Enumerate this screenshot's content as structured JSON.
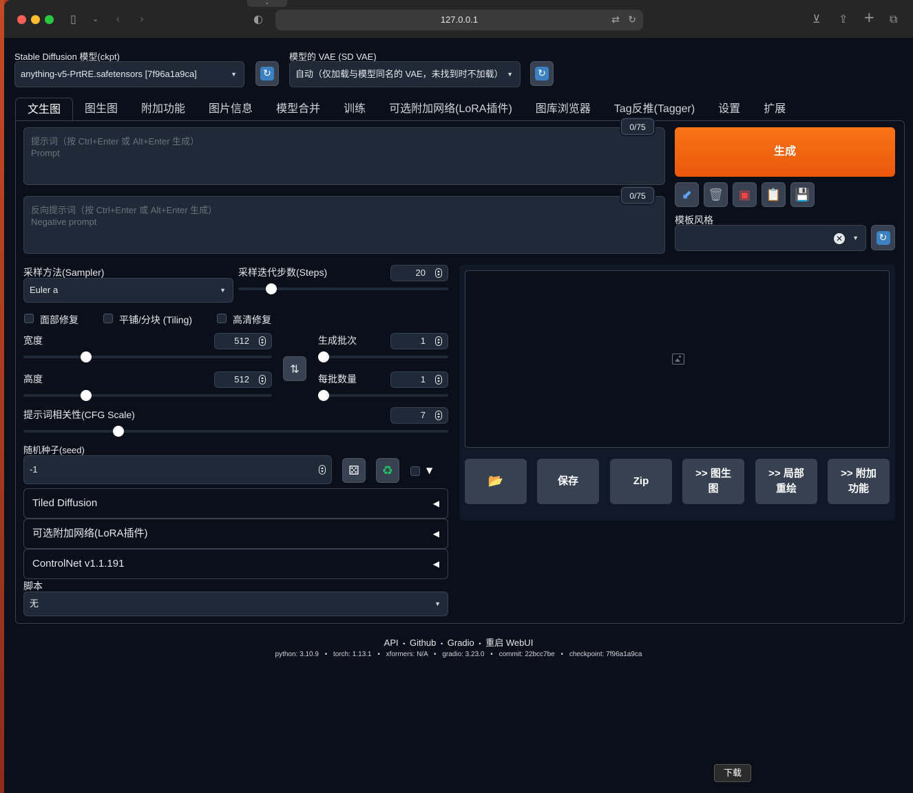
{
  "browser": {
    "url": "127.0.0.1",
    "colors": {
      "close": "#ff5f57",
      "minimize": "#febc2e",
      "maximize": "#28c840"
    }
  },
  "model": {
    "ckpt_label": "Stable Diffusion 模型(ckpt)",
    "ckpt_value": "anything-v5-PrtRE.safetensors [7f96a1a9ca]",
    "vae_label": "模型的 VAE (SD VAE)",
    "vae_value": "自动（仅加载与模型同名的 VAE，未找到时不加载）"
  },
  "tabs": [
    {
      "label": "文生图",
      "active": true
    },
    {
      "label": "图生图"
    },
    {
      "label": "附加功能"
    },
    {
      "label": "图片信息"
    },
    {
      "label": "模型合并"
    },
    {
      "label": "训练"
    },
    {
      "label": "可选附加网络(LoRA插件)"
    },
    {
      "label": "图库浏览器"
    },
    {
      "label": "Tag反推(Tagger)"
    },
    {
      "label": "设置"
    },
    {
      "label": "扩展"
    }
  ],
  "prompt": {
    "placeholder_line1": "提示词（按 Ctrl+Enter 或 Alt+Enter 生成）",
    "placeholder_line2": "Prompt",
    "token_count": "0/75"
  },
  "negative_prompt": {
    "placeholder_line1": "反向提示词（按 Ctrl+Enter 或 Alt+Enter 生成）",
    "placeholder_line2": "Negative prompt",
    "token_count": "0/75"
  },
  "generate": {
    "label": "生成",
    "color": "#f97316"
  },
  "style": {
    "label": "模板风格",
    "clear": "✕"
  },
  "sampler": {
    "label": "采样方法(Sampler)",
    "value": "Euler a"
  },
  "steps": {
    "label": "采样迭代步数(Steps)",
    "value": "20",
    "level": 0.13
  },
  "checkboxes": {
    "face_restore": "面部修复",
    "tiling": "平铺/分块 (Tiling)",
    "hires_fix": "高清修复"
  },
  "width": {
    "label": "宽度",
    "value": "512",
    "level": 0.23
  },
  "height": {
    "label": "高度",
    "value": "512",
    "level": 0.23
  },
  "batch_count": {
    "label": "生成批次",
    "value": "1",
    "level": 0.0
  },
  "batch_size": {
    "label": "每批数量",
    "value": "1",
    "level": 0.0
  },
  "cfg": {
    "label": "提示词相关性(CFG Scale)",
    "value": "7",
    "level": 0.21
  },
  "seed": {
    "label": "随机种子(seed)",
    "value": "-1"
  },
  "accordions": {
    "tiled_diffusion": "Tiled Diffusion",
    "lora": "可选附加网络(LoRA插件)",
    "controlnet": "ControlNet v1.1.191"
  },
  "script": {
    "label": "脚本",
    "value": "无"
  },
  "output_buttons": {
    "save": "保存",
    "zip": "Zip",
    "to_img2img": ">> 图生图",
    "to_inpaint": ">> 局部重绘",
    "to_extras": ">> 附加功能"
  },
  "footer": {
    "api": "API",
    "github": "Github",
    "gradio": "Gradio",
    "reload": "重启 WebUI",
    "sep": "•",
    "python": "python: 3.10.9",
    "torch": "torch: 1.13.1",
    "xformers": "xformers: N/A",
    "gradio_ver": "gradio: 3.23.0",
    "commit": "commit: 22bcc7be",
    "checkpoint": "checkpoint: 7f96a1a9ca"
  },
  "tooltip": {
    "label": "下载"
  }
}
